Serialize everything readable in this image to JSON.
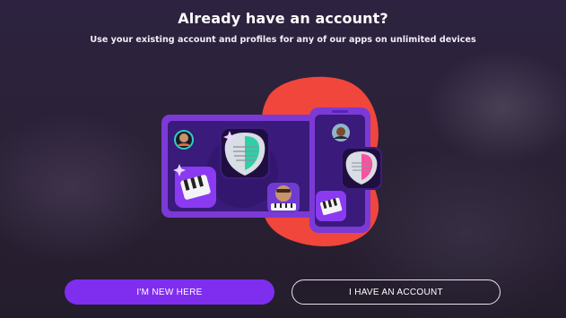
{
  "header": {
    "title": "Already have an account?",
    "subtitle": "Use your existing account and profiles for any of our apps on unlimited devices"
  },
  "illustration": {
    "icons": [
      "red-blob",
      "tablet-icon",
      "phone-icon",
      "guitar-app-icon",
      "piano-app-icon",
      "avatar-icon",
      "music-character-icon",
      "sparkle-icon"
    ]
  },
  "actions": {
    "new_label": "I'M NEW HERE",
    "have_account_label": "I HAVE AN ACCOUNT"
  },
  "colors": {
    "primary": "#7f2ef0",
    "accent_red": "#f0463c",
    "device": "#5a22b8",
    "background": "#2c2238"
  }
}
